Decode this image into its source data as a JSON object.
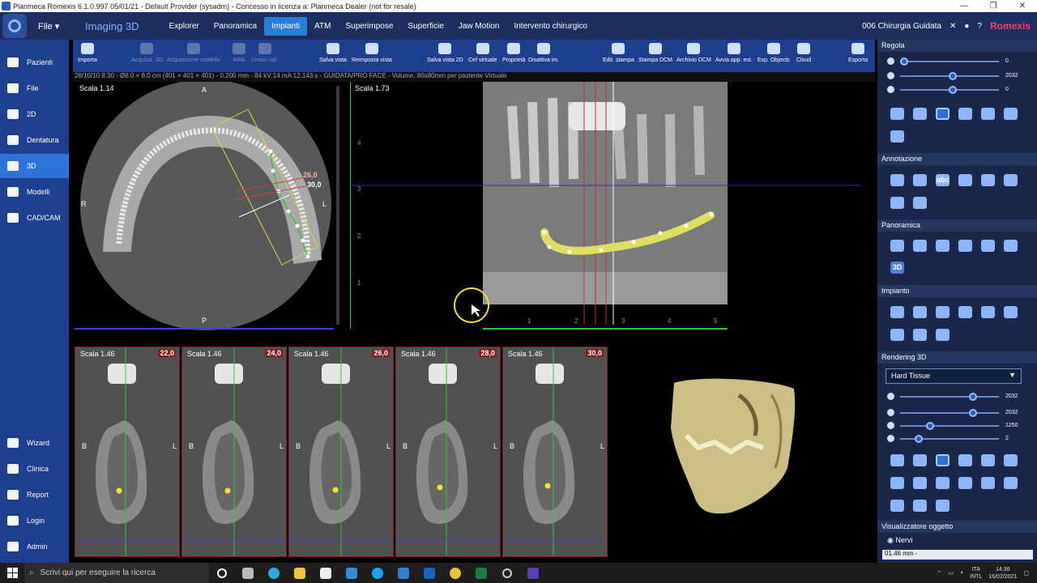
{
  "window": {
    "title": "Planmeca Romexis 6.1.0.997 05/01/21 - Default Provider (sysadm) - Concesso in licenza a: Planmeca Dealer (not for resale)",
    "minimize": "—",
    "maximize": "❐",
    "close": "✕"
  },
  "topnav": {
    "file_menu": "File ▾",
    "module_title": "Imaging 3D",
    "tabs": [
      "Explorer",
      "Panoramica",
      "Impianti",
      "ATM",
      "Superimpose",
      "Superficie",
      "Jaw Motion",
      "Intervento chirurgico"
    ],
    "active_tab": "Impianti",
    "patient": "006 Chirurgia Guidata",
    "brand": "Romexis"
  },
  "sidebar": {
    "items": [
      {
        "label": "Pazienti"
      },
      {
        "label": "File"
      },
      {
        "label": "2D"
      },
      {
        "label": "Dentatura"
      },
      {
        "label": "3D"
      },
      {
        "label": "Modelli"
      },
      {
        "label": "CAD/CAM"
      }
    ],
    "bottom_items": [
      {
        "label": "Wizard"
      },
      {
        "label": "Clinica"
      },
      {
        "label": "Report"
      },
      {
        "label": "Login"
      },
      {
        "label": "Admin"
      }
    ],
    "active": "3D"
  },
  "toolbar": {
    "buttons": [
      {
        "label": "Importa",
        "enabled": true
      },
      {
        "label": "Acquisiz. 3D",
        "enabled": false
      },
      {
        "label": "Acquisizione modello",
        "enabled": false
      },
      {
        "label": "ARA",
        "enabled": false
      },
      {
        "label": "Unisci vol.",
        "enabled": false
      },
      {
        "label": "Salva vista",
        "enabled": true
      },
      {
        "label": "Reimposta vista",
        "enabled": true
      },
      {
        "label": "Salva vista 2D",
        "enabled": true
      },
      {
        "label": "Cef virtuale",
        "enabled": true
      },
      {
        "label": "Proprietà",
        "enabled": true
      },
      {
        "label": "Disattiva im.",
        "enabled": true
      },
      {
        "label": "Edit. stampa",
        "enabled": true
      },
      {
        "label": "Stampa DCM",
        "enabled": true
      },
      {
        "label": "Archivio DCM",
        "enabled": true
      },
      {
        "label": "Avvia app. est.",
        "enabled": true
      },
      {
        "label": "Exp. Objects",
        "enabled": true
      },
      {
        "label": "Cloud",
        "enabled": true
      },
      {
        "label": "Esporta",
        "enabled": true
      }
    ]
  },
  "infoline": "28/10/10 8.30 - Ø8.0 × 8.0 cm (401 × 401 × 401) - 0.200 mm - 84 kV 14 mA 12.143 s - GUIDATA/PRO FACE - Volume, 80x80mm per paziente Virtuale",
  "axial_view": {
    "scale": "Scala 1.14",
    "orient_top": "A",
    "orient_bottom": "P",
    "orient_left": "R",
    "orient_right": "L",
    "cut_label_1": "26,0",
    "cut_label_2": "30,0"
  },
  "panoramic_view": {
    "scale": "Scala 1.73",
    "ruler_left": [
      "4",
      "3",
      "2",
      "1"
    ],
    "ruler_bottom": [
      "1",
      "2",
      "3",
      "4",
      "5"
    ]
  },
  "cross_sections": [
    {
      "scale": "Scala 1.46",
      "pos": "22,0"
    },
    {
      "scale": "Scala 1.46",
      "pos": "24,0"
    },
    {
      "scale": "Scala 1.46",
      "pos": "26,0"
    },
    {
      "scale": "Scala 1.46",
      "pos": "28,0"
    },
    {
      "scale": "Scala 1.46",
      "pos": "30,0"
    }
  ],
  "cross_orient": {
    "left": "B",
    "right": "L"
  },
  "right_panel": {
    "regola": {
      "title": "Regola",
      "values": [
        "0",
        "2032",
        "0"
      ]
    },
    "annotazione": {
      "title": "Annotazione",
      "text_tool": "abc"
    },
    "panoramica": {
      "title": "Panoramica",
      "label_3d": "3D"
    },
    "impianto": {
      "title": "Impianto"
    },
    "rendering": {
      "title": "Rendering 3D",
      "preset": "Hard Tissue",
      "values": [
        "2032",
        "2032",
        "1250",
        "2"
      ]
    },
    "visualizzatore": {
      "title": "Visualizzatore oggetto",
      "item": "Nervi",
      "sub_item": "01.46 mm -"
    }
  },
  "taskbar": {
    "search_placeholder": "Scrivi qui per eseguire la ricerca",
    "lang": "ITA",
    "lang2": "INTL",
    "time": "14:36",
    "date": "16/02/2021"
  }
}
